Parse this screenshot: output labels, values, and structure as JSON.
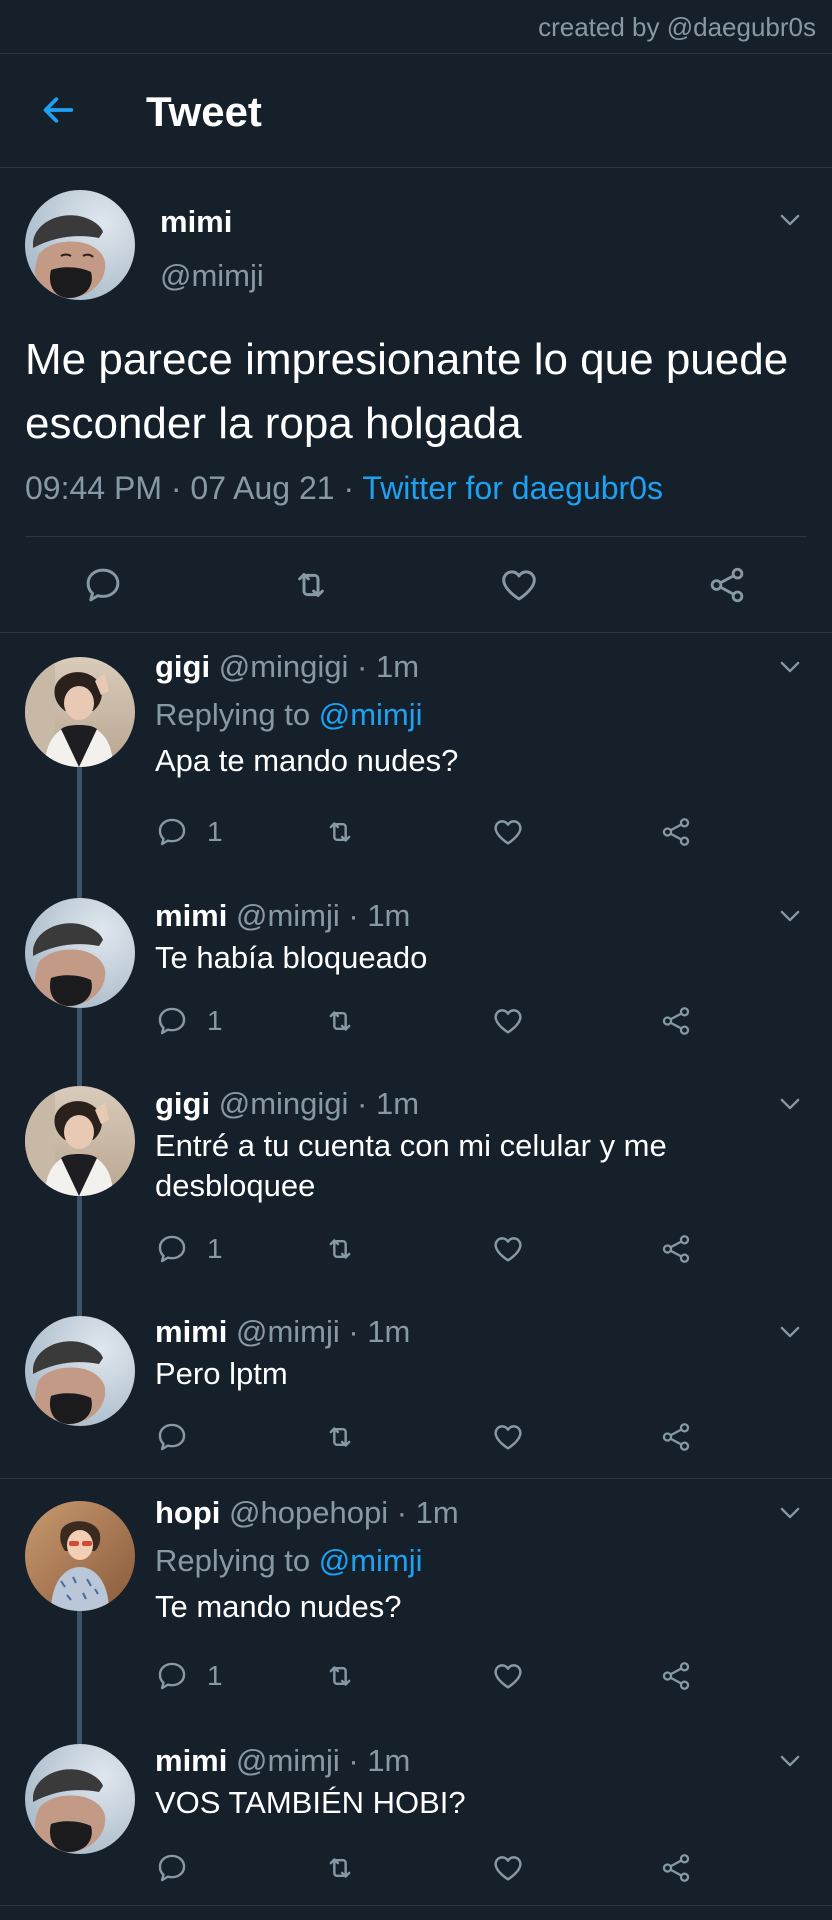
{
  "credit": "created by @daegubr0s",
  "header": {
    "title": "Tweet"
  },
  "main_tweet": {
    "name": "mimi",
    "handle": "@mimji",
    "text": "Me parece impresionante lo que puede esconder la ropa holgada",
    "time": "09:44 PM · 07 Aug 21 · ",
    "source": "Twitter for daegubr0s"
  },
  "replies": [
    {
      "name": "gigi",
      "handle": "@mingigi",
      "time": " · 1m",
      "replying_prefix": "Replying to ",
      "replying_to": "@mimji",
      "text": "Apa te mando nudes?",
      "reply_count": "1"
    },
    {
      "name": "mimi",
      "handle": "@mimji",
      "time": " · 1m",
      "text": "Te había bloqueado",
      "reply_count": "1"
    },
    {
      "name": "gigi",
      "handle": "@mingigi",
      "time": " · 1m",
      "text": "Entré a tu cuenta con mi celular y me desbloquee",
      "reply_count": "1"
    },
    {
      "name": "mimi",
      "handle": "@mimji",
      "time": " · 1m",
      "text": "Pero lptm",
      "reply_count": ""
    },
    {
      "name": "hopi",
      "handle": "@hopehopi",
      "time": " · 1m",
      "replying_prefix": "Replying to ",
      "replying_to": "@mimji",
      "text": "Te mando nudes?",
      "reply_count": "1"
    },
    {
      "name": "mimi",
      "handle": "@mimji",
      "time": " · 1m",
      "text": "VOS TAMBIÉN HOBI?",
      "reply_count": ""
    }
  ],
  "colors": {
    "background": "#15202b",
    "accent": "#1da1f2",
    "muted": "#8899a6",
    "divider": "#2a3743",
    "thread_line": "#3d5466"
  },
  "icons": [
    "back-arrow-icon",
    "chevron-down-icon",
    "reply-icon",
    "retweet-icon",
    "like-icon",
    "share-icon"
  ]
}
